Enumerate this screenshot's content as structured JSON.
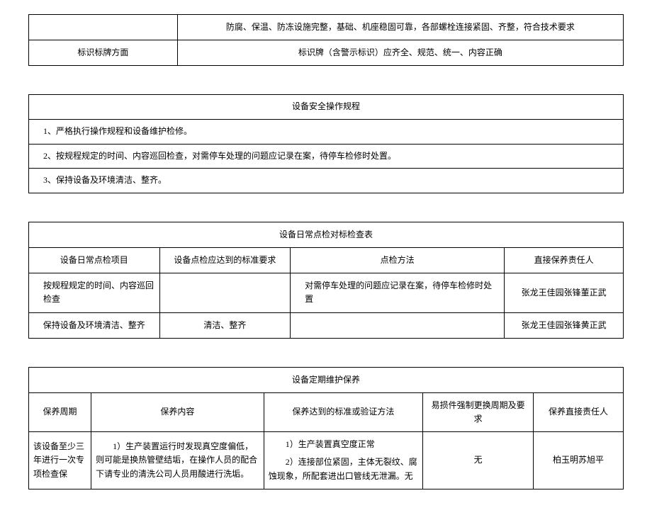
{
  "table1": {
    "row1_right": "防腐、保温、防冻设施完整，基础、机座稳固可靠，各部螺栓连接紧固、齐整，符合技术要求",
    "row2_left": "标识标牌方面",
    "row2_right": "标识牌（含警示标识）应齐全、规范、统一、内容正确"
  },
  "table2": {
    "title": "设备安全操作规程",
    "item1": "1、严格执行操作规程和设备维护检修。",
    "item2": "2、按规程规定的时间、内容巡回检查，对需停车处理的问题应记录在案，待停车检修时处置。",
    "item3": "3、保持设备及环境清洁、整齐。"
  },
  "table3": {
    "title": "设备日常点检对标检查表",
    "h1": "设备日常点检项目",
    "h2": "设备点检应达到的标准要求",
    "h3": "点检方法",
    "h4": "直接保养责任人",
    "r1c1": "按规程规定的时间、内容巡回检查",
    "r1c2": "",
    "r1c3": "对需停车处理的问题应记录在案，待停车检修时处置",
    "r1c4": "张龙王佳园张锋董正武",
    "r2c1": "保持设备及环境清洁、整齐",
    "r2c2": "清洁、整齐",
    "r2c3": "",
    "r2c4": "张龙王佳园张锋黄正武"
  },
  "table4": {
    "title": "设备定期维护保养",
    "h1": "保养周期",
    "h2": "保养内容",
    "h3": "保养达到的标准或验证方法",
    "h4": "易损件强制更换周期及要求",
    "h5": "保养直接责任人",
    "r1c1": "该设备至少三年进行一次专项检查保",
    "r1c2": "　　1）生产装置运行时发现真空度偏低，则可能是换热管壁结垢，在操作人员的配合下请专业的清洗公司人员用酸进行洗垢。",
    "r1c3_line1": "　　1）生产装置真空度正常",
    "r1c3_line2": "　　2）连接部位紧固，主体无裂纹、腐蚀现象，所配套进出口管线无泄漏。无",
    "r1c4": "无",
    "r1c5": "柏玉明苏旭平"
  }
}
